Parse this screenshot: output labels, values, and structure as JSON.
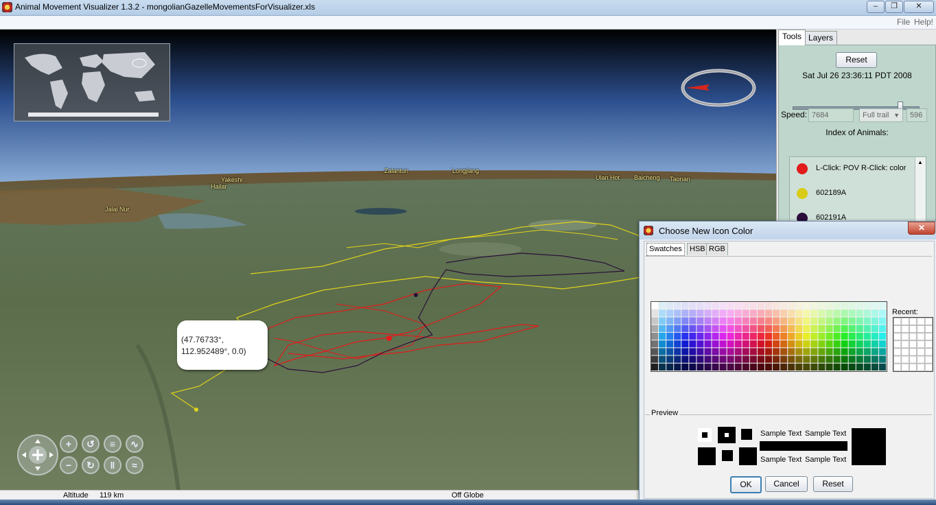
{
  "window": {
    "title": "Animal Movement Visualizer 1.3.2 - mongolianGazelleMovementsForVisualizer.xls",
    "controls": [
      "–",
      "❐",
      "✕"
    ]
  },
  "menu": {
    "file": "File",
    "help": "Help!"
  },
  "globe": {
    "place_labels": [
      "Yakeshi",
      "Hailar",
      "Jalai Nur",
      "Zalantun",
      "Longjiang",
      "Ulan Hot",
      "Baicheng",
      "Taonan"
    ],
    "callout": {
      "line1": "(47.76733°,",
      "line2": "112.952489°, 0.0)"
    },
    "nav_icons": [
      "zoom-in-icon",
      "zoom-out-icon",
      "rotate-left-icon",
      "rotate-right-icon",
      "tilt-up-icon",
      "tilt-down-icon",
      "elevation-up-icon",
      "elevation-down-icon"
    ]
  },
  "status": {
    "altitude_label": "Altitude",
    "altitude_value": "119 km",
    "globe_state": "Off Globe"
  },
  "side": {
    "tabs": [
      "Tools",
      "Layers"
    ],
    "reset": "Reset",
    "datetime": "Sat Jul 26 23:36:11 PDT 2008",
    "timeline_position": 0.85,
    "speed_label": "Speed:",
    "speed_value": "7684",
    "trail_option": "Full trail",
    "trail_length": "596",
    "index_title": "Index of Animals:",
    "animals": [
      {
        "label": "L-Click: POV R-Click: color",
        "color": "#e21b1b"
      },
      {
        "label": "602189A",
        "color": "#d8cc16"
      },
      {
        "label": "602191A",
        "color": "#2a0f3a"
      }
    ]
  },
  "dialog": {
    "title": "Choose New Icon Color",
    "close": "✕",
    "tabs": [
      "Swatches",
      "HSB",
      "RGB"
    ],
    "recent_label": "Recent:",
    "preview_label": "Preview",
    "sample_text": "Sample Text",
    "ok": "OK",
    "cancel": "Cancel",
    "reset": "Reset",
    "selected_color": "#000000"
  }
}
